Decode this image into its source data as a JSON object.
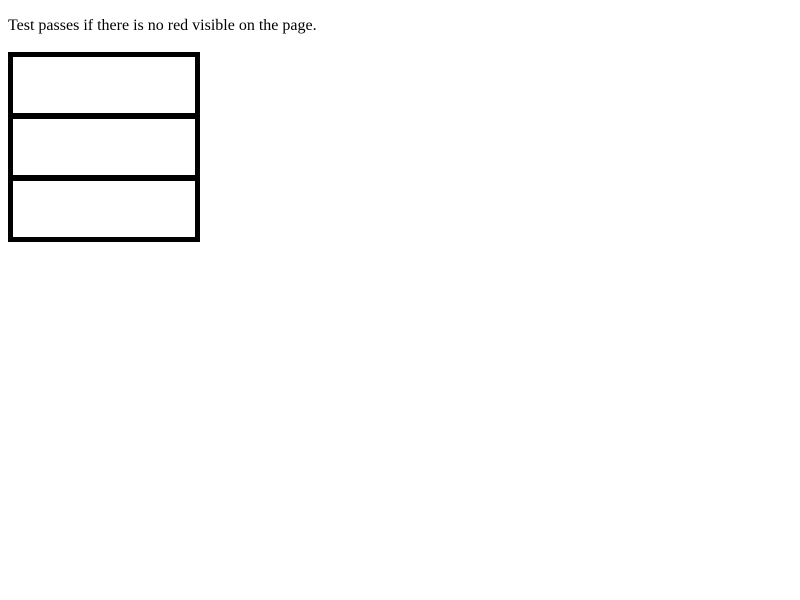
{
  "instruction": "Test passes if there is no red visible on the page.",
  "boxes": [
    {
      "id": "box-1"
    },
    {
      "id": "box-2"
    },
    {
      "id": "box-3"
    }
  ],
  "colors": {
    "border": "#000000",
    "background": "#ffffff"
  }
}
